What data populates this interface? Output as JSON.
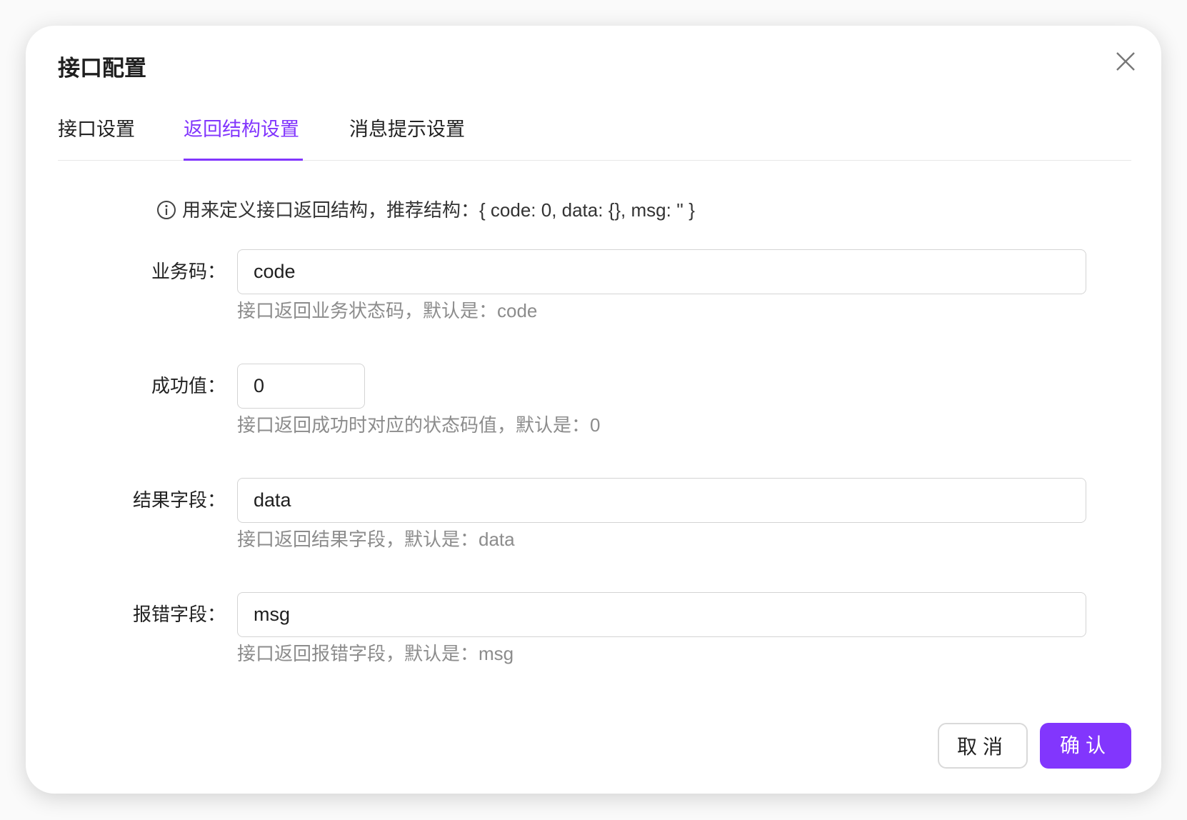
{
  "dialog": {
    "title": "接口配置",
    "close_icon": "close-icon",
    "accent_color": "#8236fd",
    "tabs": [
      {
        "label": "接口设置",
        "active": false
      },
      {
        "label": "返回结构设置",
        "active": true
      },
      {
        "label": "消息提示设置",
        "active": false
      }
    ],
    "info": {
      "icon": "info-circle-icon",
      "text": "用来定义接口返回结构，推荐结构：{ code: 0, data: {}, msg: '' }"
    },
    "fields": [
      {
        "label": "业务码：",
        "value": "code",
        "help": "接口返回业务状态码，默认是：code"
      },
      {
        "label": "成功值：",
        "value": "0",
        "help": "接口返回成功时对应的状态码值，默认是：0"
      },
      {
        "label": "结果字段：",
        "value": "data",
        "help": "接口返回结果字段，默认是：data"
      },
      {
        "label": "报错字段：",
        "value": "msg",
        "help": "接口返回报错字段，默认是：msg"
      }
    ],
    "buttons": {
      "cancel": "取消",
      "confirm": "确认"
    }
  }
}
